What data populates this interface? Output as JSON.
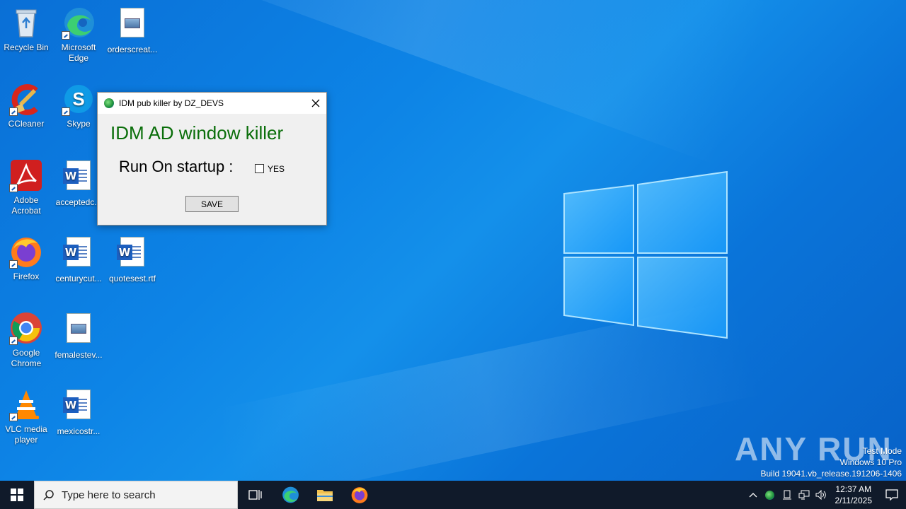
{
  "desktop": {
    "icons": [
      {
        "label": "Recycle Bin",
        "icon": "recycle-bin-icon"
      },
      {
        "label": "Microsoft Edge",
        "icon": "edge-icon"
      },
      {
        "label": "orderscreat...",
        "icon": "image-file-icon"
      },
      {
        "label": "CCleaner",
        "icon": "ccleaner-icon"
      },
      {
        "label": "Skype",
        "icon": "skype-icon"
      },
      {
        "label": "Adobe Acrobat",
        "icon": "acrobat-icon"
      },
      {
        "label": "acceptedc...",
        "icon": "word-doc-icon"
      },
      {
        "label": "Firefox",
        "icon": "firefox-icon"
      },
      {
        "label": "centurycut...",
        "icon": "word-doc-icon"
      },
      {
        "label": "quotesest.rtf",
        "icon": "word-doc-icon"
      },
      {
        "label": "Google Chrome",
        "icon": "chrome-icon"
      },
      {
        "label": "femalestev...",
        "icon": "image-file-icon"
      },
      {
        "label": "VLC media player",
        "icon": "vlc-icon"
      },
      {
        "label": "mexicostr...",
        "icon": "word-doc-icon"
      }
    ]
  },
  "dialog": {
    "title": "IDM pub killer by DZ_DEVS",
    "heading": "IDM AD window killer",
    "run_label": "Run On startup :",
    "checkbox_label": "YES",
    "checkbox_checked": false,
    "save_label": "SAVE",
    "heading_color": "#0a6e0a"
  },
  "watermark": {
    "brand": "ANY RUN",
    "line1": "Test Mode",
    "line2": "Windows 10 Pro",
    "line3": "Build 19041.vb_release.191206-1406"
  },
  "taskbar": {
    "search_placeholder": "Type here to search",
    "time": "12:37 AM",
    "date": "2/11/2025"
  }
}
